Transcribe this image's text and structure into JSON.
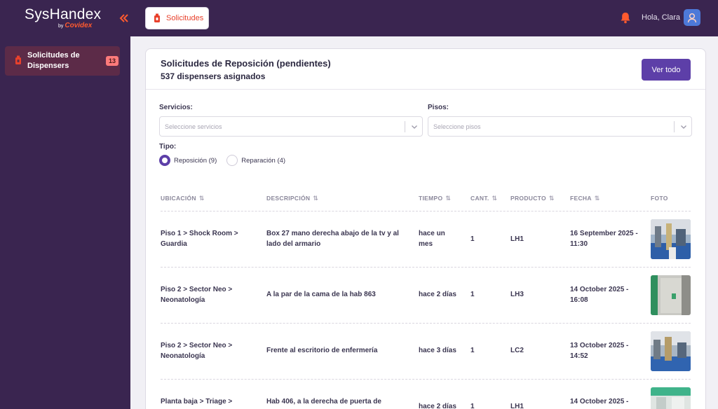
{
  "app": {
    "logo_main": "SysHandex",
    "logo_by": "by",
    "logo_brand": "Covidex",
    "tab_label": "Solicitudes",
    "greeting": "Hola, Clara"
  },
  "sidebar": {
    "items": [
      {
        "label": "Solicitudes de Dispensers",
        "badge": "13"
      }
    ]
  },
  "card": {
    "title": "Solicitudes de Reposición (pendientes)",
    "subtitle": "537 dispensers asignados",
    "view_all": "Ver todo"
  },
  "filters": {
    "servicios_label": "Servicios:",
    "servicios_placeholder": "Seleccione servicios",
    "pisos_label": "Pisos:",
    "pisos_placeholder": "Seleccione pisos",
    "tipo_label": "Tipo:",
    "tipo_options": [
      {
        "label": "Reposición (9)",
        "selected": true
      },
      {
        "label": "Reparación (4)",
        "selected": false
      }
    ]
  },
  "table": {
    "columns": [
      "UBICACIÓN",
      "DESCRIPCIÓN",
      "TIEMPO",
      "CANT.",
      "PRODUCTO",
      "FECHA",
      "FOTO"
    ],
    "rows": [
      {
        "ubicacion": "Piso 1 > Shock Room > Guardia",
        "descripcion": "Box 27 mano derecha abajo de la tv y al lado del armario",
        "tiempo": "hace un mes",
        "cantidad": "1",
        "producto": "LH1",
        "fecha": "16 September 2025 - 11:30"
      },
      {
        "ubicacion": "Piso 2 > Sector Neo > Neonatología",
        "descripcion": "A la par de la cama de la hab 863",
        "tiempo": "hace 2 días",
        "cantidad": "1",
        "producto": "LH3",
        "fecha": "14 October 2025 - 16:08"
      },
      {
        "ubicacion": "Piso 2 > Sector Neo > Neonatología",
        "descripcion": "Frente al escritorio de enfermería",
        "tiempo": "hace 3 días",
        "cantidad": "1",
        "producto": "LC2",
        "fecha": "13 October 2025 - 14:52"
      },
      {
        "ubicacion": "Planta baja > Triage >",
        "descripcion": "Hab 406, a la derecha de puerta de",
        "tiempo": "hace 2 días",
        "cantidad": "1",
        "producto": "LH1",
        "fecha": "14 October 2025 -"
      }
    ]
  },
  "colors": {
    "nav_bg": "#3a2550",
    "accent": "#5d3fa8",
    "brand_orange": "#ff5a2e",
    "badge": "#ff7b7b"
  }
}
